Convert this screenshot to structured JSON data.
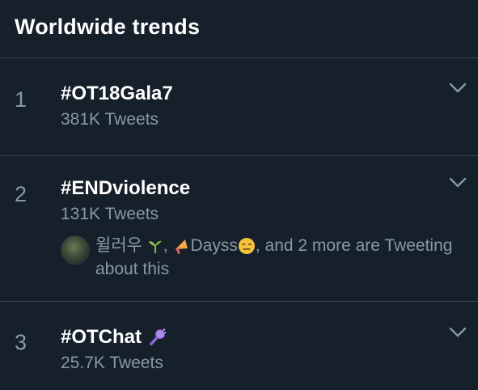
{
  "header": {
    "title": "Worldwide trends"
  },
  "trends": [
    {
      "rank": "1",
      "hashtag": "#OT18Gala7",
      "count": "381K Tweets"
    },
    {
      "rank": "2",
      "hashtag": "#ENDviolence",
      "count": "131K Tweets",
      "context": {
        "name1": "윌러우",
        "sep": ",",
        "name2": "Dayss",
        "rest": ", and 2 more are Tweeting about this"
      }
    },
    {
      "rank": "3",
      "hashtag": "#OTChat",
      "count": "25.7K Tweets"
    }
  ],
  "icons": {
    "chevron": "chevron-down-icon",
    "sprout": "sprout-emoji-icon",
    "megaphone": "megaphone-emoji-icon",
    "face": "expressionless-face-emoji-icon",
    "mic": "microphone-emoji-icon"
  },
  "colors": {
    "background": "#15202b",
    "divider": "#38444d",
    "secondary_text": "#8899a6",
    "primary_text": "#ffffff"
  }
}
